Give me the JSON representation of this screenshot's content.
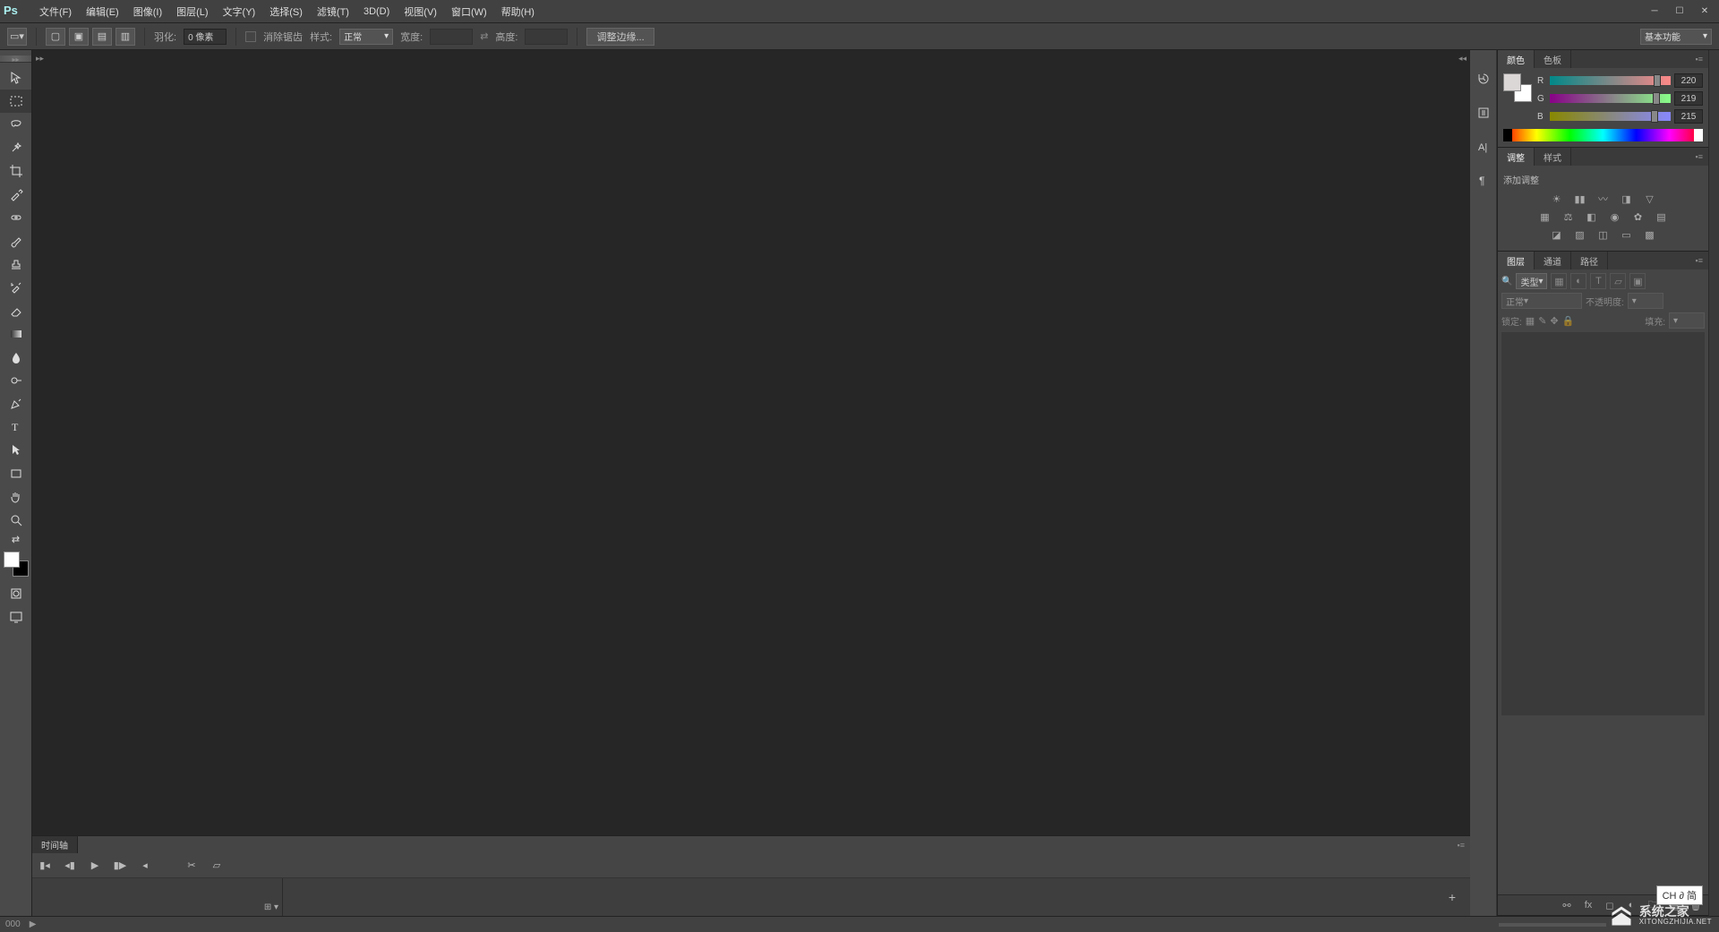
{
  "app": {
    "logo": "Ps"
  },
  "menu": [
    "文件(F)",
    "编辑(E)",
    "图像(I)",
    "图层(L)",
    "文字(Y)",
    "选择(S)",
    "滤镜(T)",
    "3D(D)",
    "视图(V)",
    "窗口(W)",
    "帮助(H)"
  ],
  "options": {
    "feather_label": "羽化:",
    "feather_value": "0 像素",
    "antialias_label": "消除锯齿",
    "style_label": "样式:",
    "style_value": "正常",
    "width_label": "宽度:",
    "height_label": "高度:",
    "refine_btn": "调整边缘...",
    "workspace": "基本功能"
  },
  "timeline": {
    "tab": "时间轴"
  },
  "panels": {
    "color": {
      "tabs": [
        "颜色",
        "色板"
      ],
      "r_label": "R",
      "g_label": "G",
      "b_label": "B",
      "r": "220",
      "g": "219",
      "b": "215"
    },
    "adjust": {
      "tabs": [
        "调整",
        "样式"
      ],
      "add_label": "添加调整"
    },
    "layers": {
      "tabs": [
        "图层",
        "通道",
        "路径"
      ],
      "kind_label": "类型",
      "blend_mode": "正常",
      "opacity_label": "不透明度:",
      "lock_label": "锁定:",
      "fill_label": "填充:"
    }
  },
  "status": {
    "info": "000",
    "arrow": "▶"
  },
  "ime": "CH ∂ 简",
  "watermark": {
    "cn": "系统之家",
    "url": "XITONGZHIJIA.NET"
  }
}
